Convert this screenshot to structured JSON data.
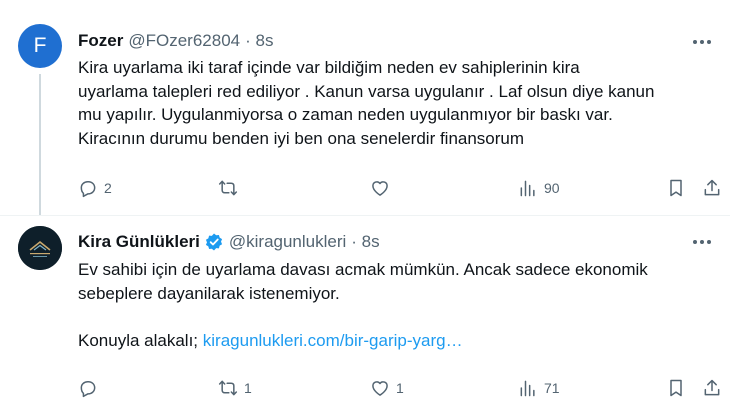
{
  "tweets": [
    {
      "avatar_letter": "F",
      "name": "Fozer",
      "handle": "@FOzer62804",
      "time": "· 8s",
      "text_lines": [
        "Kira uyarlama iki taraf içinde var bildiğim neden ev sahiplerinin kira",
        "uyarlama talepleri red ediliyor . Kanun varsa uygulanır . Laf olsun diye kanun",
        "mu yapılır. Uygulanmiyorsa o zaman neden uygulanmıyor bir baskı var.",
        "Kiracının durumu benden iyi ben ona senelerdir finansorum"
      ],
      "replies": "2",
      "retweets": "",
      "likes": "",
      "views": "90"
    },
    {
      "name": "Kira Günlükleri",
      "handle": "@kiragunlukleri",
      "time": "· 8s",
      "text_lines": [
        "Ev sahibi için de uyarlama davası acmak mümkün. Ancak sadece ekonomik",
        "sebeplere dayanilarak istenemiyor."
      ],
      "link_prefix": "Konuyla alakalı;",
      "link_text": "kiragunlukleri.com/bir-garip-yarg…",
      "replies": "",
      "retweets": "1",
      "likes": "1",
      "views": "71"
    }
  ],
  "colors": {
    "accent": "#1d9bf0",
    "muted": "#536471",
    "text": "#0f1419",
    "avatar_f": "#1f6fd1"
  },
  "icons": [
    "more-icon",
    "reply-icon",
    "retweet-icon",
    "like-icon",
    "views-icon",
    "bookmark-icon",
    "share-icon",
    "verified-badge-icon"
  ]
}
